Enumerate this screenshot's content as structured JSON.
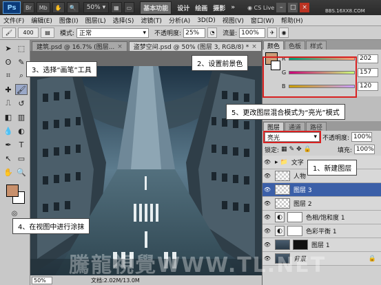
{
  "topbar": {
    "zoom": "50%",
    "workspaces": [
      "基本功能",
      "设计",
      "绘画",
      "摄影"
    ],
    "more": "»",
    "cs_live": "CS Live",
    "site": "BBS.16XX8.COM"
  },
  "menus": [
    "文件(F)",
    "编辑(E)",
    "图像(I)",
    "图层(L)",
    "选择(S)",
    "滤镜(T)",
    "分析(A)",
    "3D(D)",
    "视图(V)",
    "窗口(W)",
    "帮助(H)"
  ],
  "options": {
    "brush_size": "400",
    "mode_label": "模式:",
    "mode_value": "正常",
    "opacity_label": "不透明度:",
    "opacity_value": "25%",
    "flow_label": "流量:",
    "flow_value": "100%"
  },
  "doc_tabs": [
    {
      "label": "建筑.psd @ 16.7% (图层...",
      "close": "×"
    },
    {
      "label": "盗梦空间.psd @ 50% (图层 3, RGB/8) *",
      "close": "×"
    }
  ],
  "status": {
    "zoom": "50%",
    "doc": "文档:2.02M/13.0M"
  },
  "color_panel": {
    "tabs": [
      "颜色",
      "色板",
      "样式"
    ],
    "r_label": "R",
    "r_value": "202",
    "g_label": "G",
    "g_value": "157",
    "b_label": "B",
    "b_value": "120",
    "foreground": "#ca9d78"
  },
  "layers_panel": {
    "tabs": [
      "图层",
      "通道",
      "路径"
    ],
    "blend_mode": "亮光",
    "opacity_label": "不透明度:",
    "opacity_value": "100%",
    "lock_label": "锁定:",
    "fill_label": "填充:",
    "fill_value": "100%",
    "layers": [
      {
        "name": "文字",
        "kind": "folder"
      },
      {
        "name": "人物",
        "kind": "layer"
      },
      {
        "name": "图层 3",
        "kind": "layer",
        "selected": true
      },
      {
        "name": "图层 2",
        "kind": "layer"
      },
      {
        "name": "色相/饱和度 1",
        "kind": "adjust"
      },
      {
        "name": "色彩平衡 1",
        "kind": "adjust"
      },
      {
        "name": "图层 1",
        "kind": "photo"
      },
      {
        "name": "背景",
        "kind": "photo"
      }
    ]
  },
  "annotations": {
    "step1": "1、新建图层",
    "step2": "2、设置前景色",
    "step3": "3、选择“画笔”工具",
    "step4": "4、在视图中进行涂抹",
    "step5": "5、更改图层混合模式为“亮光”模式"
  },
  "watermark": "騰龍視覺WWW.TL.NET"
}
